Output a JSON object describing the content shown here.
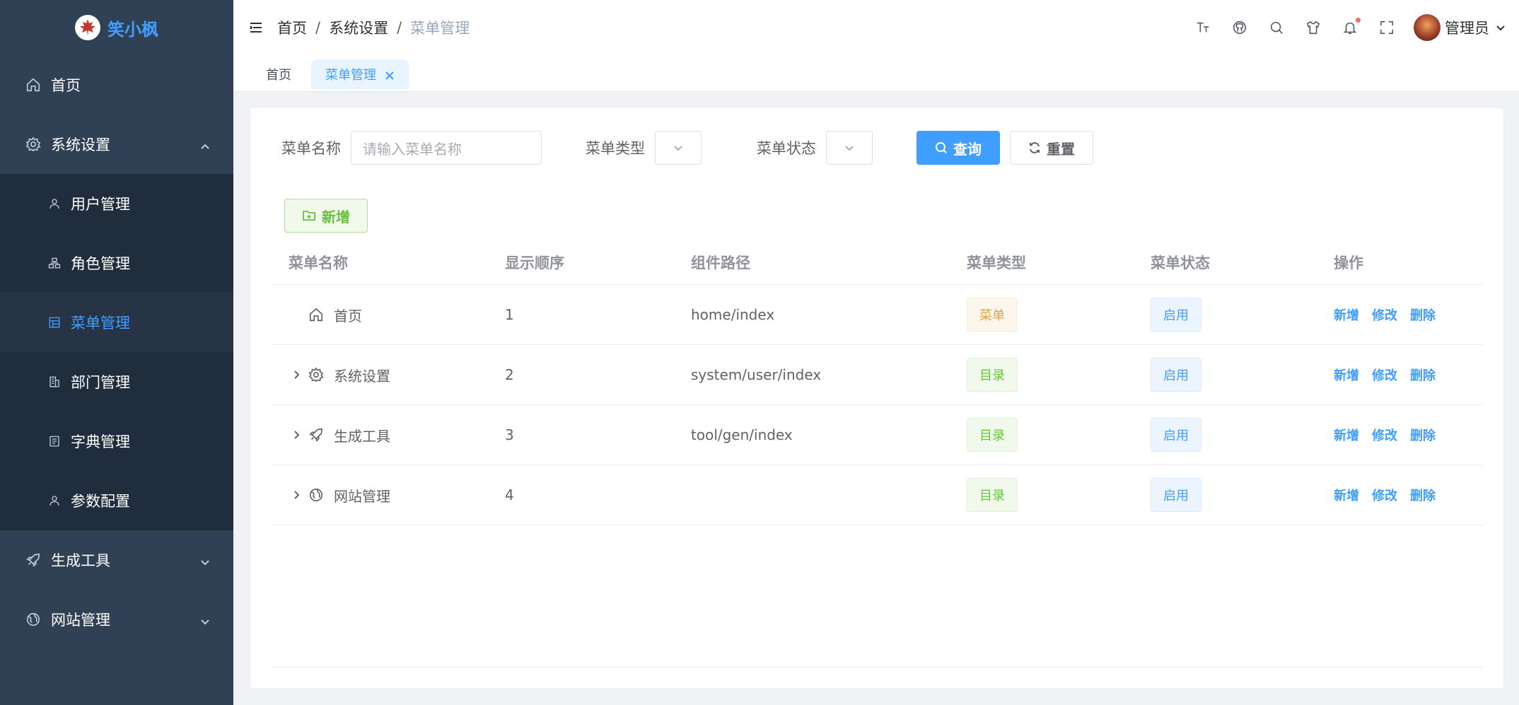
{
  "app": {
    "name": "笑小枫"
  },
  "sidebar": {
    "items": [
      {
        "label": "首页",
        "icon": "home-icon",
        "level": 1
      },
      {
        "label": "系统设置",
        "icon": "gear-icon",
        "level": 1,
        "expanded": true
      },
      {
        "label": "用户管理",
        "icon": "user-icon",
        "level": 2
      },
      {
        "label": "角色管理",
        "icon": "org-icon",
        "level": 2
      },
      {
        "label": "菜单管理",
        "icon": "tree-table-icon",
        "level": 2,
        "active": true
      },
      {
        "label": "部门管理",
        "icon": "building-icon",
        "level": 2
      },
      {
        "label": "字典管理",
        "icon": "dict-icon",
        "level": 2
      },
      {
        "label": "参数配置",
        "icon": "user-icon",
        "level": 2
      },
      {
        "label": "生成工具",
        "icon": "rocket-icon",
        "level": 1
      },
      {
        "label": "网站管理",
        "icon": "globe-icon",
        "level": 1
      }
    ]
  },
  "header": {
    "breadcrumb": [
      "首页",
      "系统设置",
      "菜单管理"
    ],
    "breadcrumb_sep": "/",
    "user_name": "管理员"
  },
  "tags": {
    "home": "首页",
    "active": "菜单管理"
  },
  "search": {
    "name_label": "菜单名称",
    "name_placeholder": "请输入菜单名称",
    "type_label": "菜单类型",
    "status_label": "菜单状态",
    "query_button": "查询",
    "reset_button": "重置"
  },
  "toolbar": {
    "add_button": "新增"
  },
  "table": {
    "headers": [
      "菜单名称",
      "显示顺序",
      "组件路径",
      "菜单类型",
      "菜单状态",
      "操作"
    ],
    "rows": [
      {
        "name": "首页",
        "icon": "home-icon",
        "expandable": false,
        "order": "1",
        "path": "home/index",
        "type": "菜单",
        "type_style": "warning",
        "status": "启用"
      },
      {
        "name": "系统设置",
        "icon": "gear-icon",
        "expandable": true,
        "order": "2",
        "path": "system/user/index",
        "type": "目录",
        "type_style": "success",
        "status": "启用"
      },
      {
        "name": "生成工具",
        "icon": "rocket-icon",
        "expandable": true,
        "order": "3",
        "path": "tool/gen/index",
        "type": "目录",
        "type_style": "success",
        "status": "启用"
      },
      {
        "name": "网站管理",
        "icon": "globe-icon",
        "expandable": true,
        "order": "4",
        "path": "",
        "type": "目录",
        "type_style": "success",
        "status": "启用"
      }
    ],
    "actions": [
      "新增",
      "修改",
      "删除"
    ]
  },
  "colors": {
    "sidebar_bg": "#304156",
    "primary": "#409eff",
    "success": "#67c23a",
    "warning": "#e6a23c",
    "danger": "#f56c6c"
  }
}
